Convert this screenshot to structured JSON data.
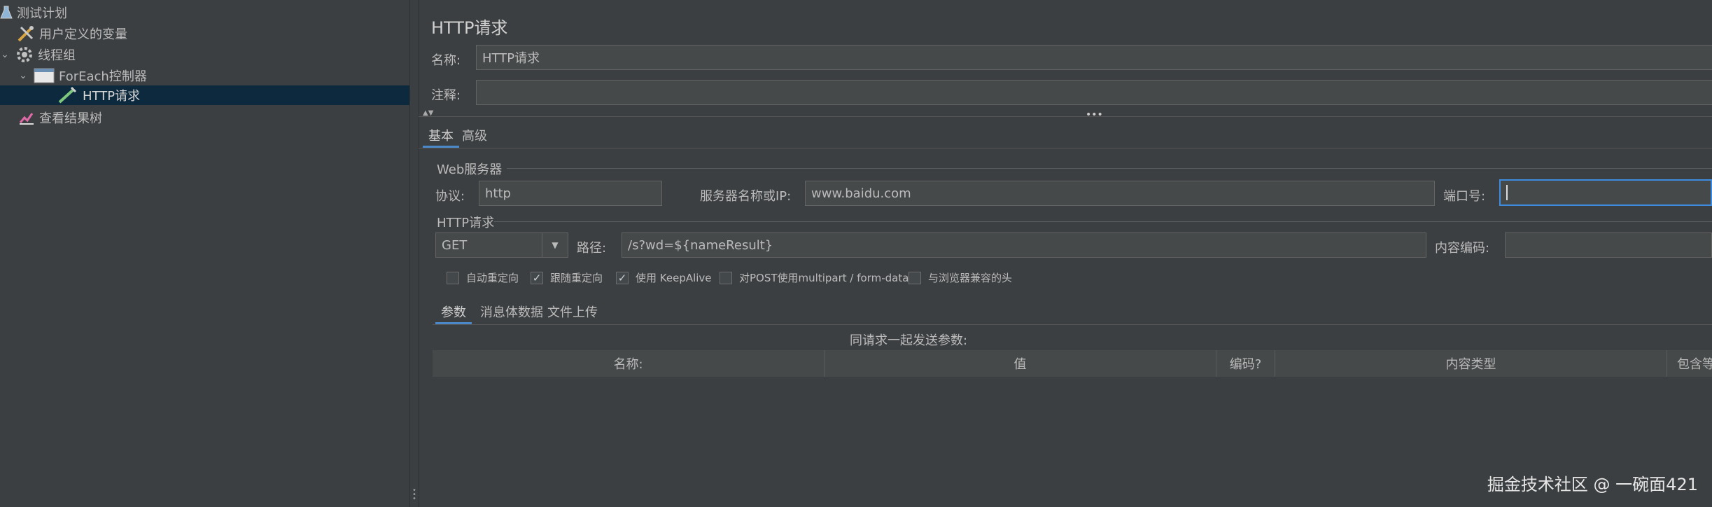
{
  "tree": {
    "items": [
      {
        "label": "测试计划"
      },
      {
        "label": "用户定义的变量"
      },
      {
        "label": "线程组"
      },
      {
        "label": "ForEach控制器"
      },
      {
        "label": "HTTP请求"
      },
      {
        "label": "查看结果树"
      }
    ]
  },
  "panel": {
    "title": "HTTP请求",
    "name_label": "名称:",
    "name_value": "HTTP请求",
    "comment_label": "注释:",
    "comment_value": "",
    "tabs": {
      "basic": "基本",
      "advanced": "高级"
    },
    "web_server": {
      "legend": "Web服务器",
      "protocol_label": "协议:",
      "protocol_value": "http",
      "server_label": "服务器名称或IP:",
      "server_value": "www.baidu.com",
      "port_label": "端口号:",
      "port_value": ""
    },
    "http_request": {
      "legend": "HTTP请求",
      "method": "GET",
      "path_label": "路径:",
      "path_value": "/s?wd=${nameResult}",
      "encoding_label": "内容编码:",
      "encoding_value": ""
    },
    "options": [
      {
        "label": "自动重定向",
        "checked": false
      },
      {
        "label": "跟随重定向",
        "checked": true
      },
      {
        "label": "使用 KeepAlive",
        "checked": true
      },
      {
        "label": "对POST使用multipart / form-data",
        "checked": false
      },
      {
        "label": "与浏览器兼容的头",
        "checked": false
      }
    ],
    "subtabs": {
      "params": "参数",
      "body": "消息体数据",
      "files": "文件上传"
    },
    "params_caption": "同请求一起发送参数:",
    "columns": [
      "名称:",
      "值",
      "编码?",
      "内容类型",
      "包含等"
    ]
  },
  "watermark": "掘金技术社区 @ 一碗面421"
}
